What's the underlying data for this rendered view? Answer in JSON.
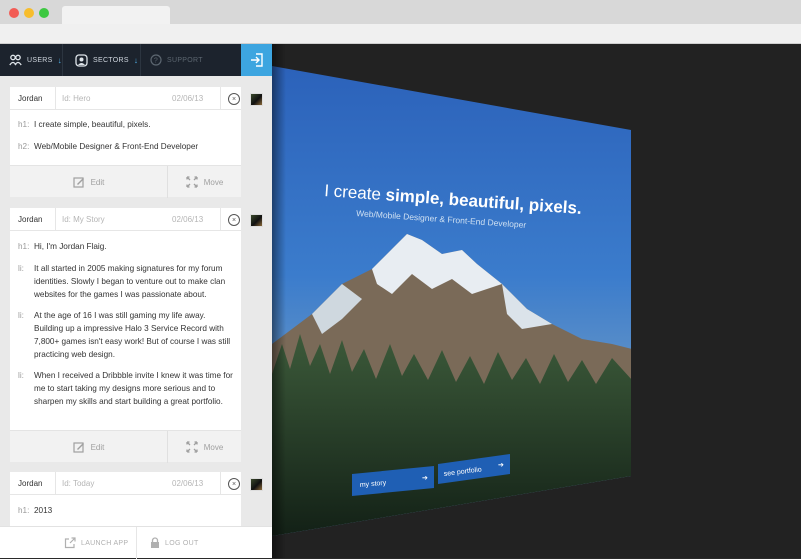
{
  "nav": {
    "users_label": "USERS",
    "sectors_label": "SECTORS",
    "support_label": "SUPPORT"
  },
  "cards": [
    {
      "author": "Jordan",
      "id_label": "Id: Hero",
      "date": "02/06/13",
      "rows": [
        {
          "tag": "h1:",
          "text": "I create simple, beautiful, pixels."
        },
        {
          "tag": "h2:",
          "text": "Web/Mobile Designer & Front-End Developer"
        }
      ],
      "edit_label": "Edit",
      "move_label": "Move"
    },
    {
      "author": "Jordan",
      "id_label": "Id: My Story",
      "date": "02/06/13",
      "rows": [
        {
          "tag": "h1:",
          "text": "Hi, I'm Jordan Flaig."
        },
        {
          "tag": "li:",
          "text": "It all started in 2005 making signatures for my forum identities. Slowly I began to venture out to make clan websites for the games I was passionate about."
        },
        {
          "tag": "li:",
          "text": "At the age of 16 I was still gaming my life away. Building up a impressive Halo 3 Service Record with 7,800+ games isn't easy work! But of course I was still practicing web design."
        },
        {
          "tag": "li:",
          "text": "When I received a Dribbble invite I knew it was time for me to start taking my designs more serious and to sharpen my skills and start building a great portfolio."
        }
      ],
      "edit_label": "Edit",
      "move_label": "Move"
    },
    {
      "author": "Jordan",
      "id_label": "Id: Today",
      "date": "02/06/13",
      "rows": [
        {
          "tag": "h1:",
          "text": "2013"
        }
      ]
    }
  ],
  "bottombar": {
    "launch_label": "LAUNCH APP",
    "logout_label": "LOG OUT"
  },
  "preview": {
    "headline_light": "I create ",
    "headline_bold": "simple, beautiful, pixels.",
    "subtitle": "Web/Mobile Designer & Front-End Developer",
    "button1": "my story",
    "button2": "see portfolio"
  },
  "colors": {
    "accent": "#3da5e0",
    "nav_bg": "#1c232d",
    "preview_blue": "#2f6fc4",
    "button_blue": "#1f5fb4"
  }
}
